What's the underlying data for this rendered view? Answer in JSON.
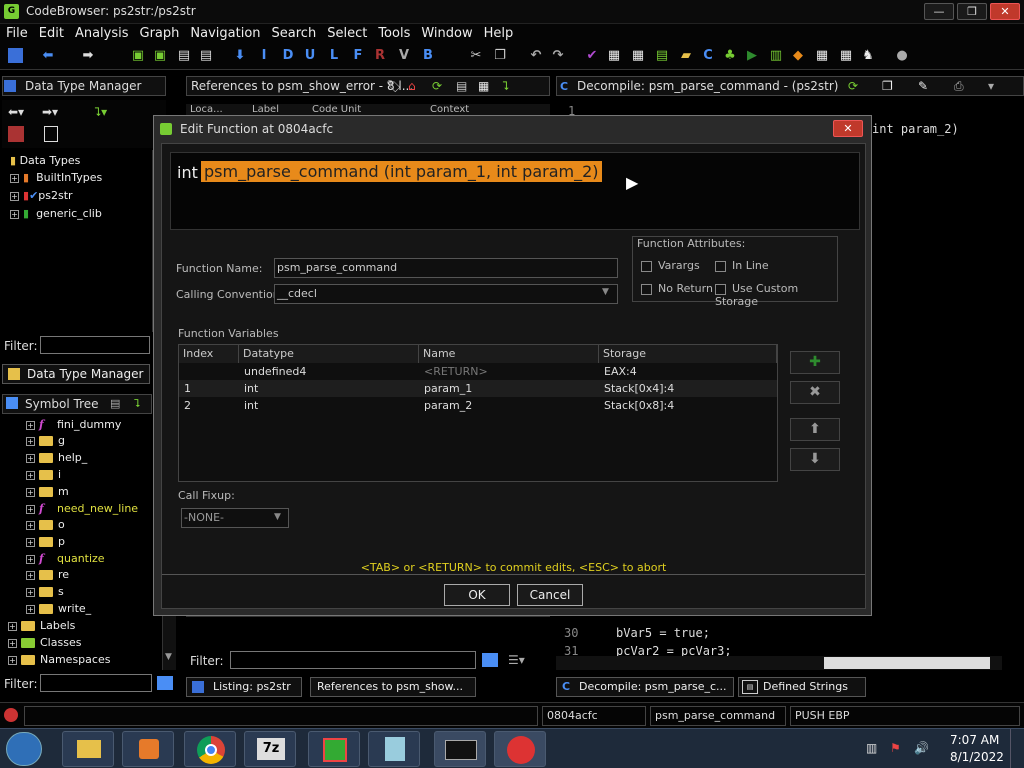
{
  "window": {
    "title": "CodeBrowser: ps2str:/ps2str",
    "controls": [
      "—",
      "❐",
      "✕"
    ]
  },
  "menu": [
    "File",
    "Edit",
    "Analysis",
    "Graph",
    "Navigation",
    "Search",
    "Select",
    "Tools",
    "Window",
    "Help"
  ],
  "toolbar_letters": [
    "I",
    "D",
    "U",
    "L",
    "F",
    "R",
    "V",
    "B"
  ],
  "dtm": {
    "title": "Data Type Manager",
    "root": "Data Types",
    "items": [
      "BuiltInTypes",
      "ps2str",
      "generic_clib"
    ],
    "filter_label": "Filter:",
    "tab_label": "Data Type Manager"
  },
  "symtree": {
    "title": "Symbol Tree",
    "items": [
      {
        "label": "fini_dummy",
        "kind": "func"
      },
      {
        "label": "g",
        "kind": "folder"
      },
      {
        "label": "help_",
        "kind": "folder"
      },
      {
        "label": "i",
        "kind": "folder"
      },
      {
        "label": "m",
        "kind": "folder"
      },
      {
        "label": "need_new_line",
        "kind": "func"
      },
      {
        "label": "o",
        "kind": "folder"
      },
      {
        "label": "p",
        "kind": "folder"
      },
      {
        "label": "quantize",
        "kind": "func"
      },
      {
        "label": "re",
        "kind": "folder"
      },
      {
        "label": "s",
        "kind": "folder"
      },
      {
        "label": "write_",
        "kind": "folder"
      }
    ],
    "roots": [
      "Labels",
      "Classes",
      "Namespaces"
    ],
    "filter_label": "Filter:"
  },
  "references": {
    "title": "References to psm_show_error - 8 l...",
    "filter_label": "Filter:",
    "col_fragments": [
      "Loca...",
      "Label",
      "Code Unit",
      "Context"
    ]
  },
  "decompile": {
    "title": "Decompile: psm_parse_command -  (ps2str)",
    "top_line_num": "1",
    "top_code": "int param_2)",
    "lines": [
      {
        "num": "30",
        "code": "bVar5 = true;"
      },
      {
        "num": "31",
        "code": "pcVar2 = pcVar3;"
      }
    ]
  },
  "dialog": {
    "title": "Edit Function at 0804acfc",
    "sig_prefix": "int",
    "sig_highlight": "psm_parse_command (int param_1, int param_2)",
    "function_name_label": "Function Name:",
    "function_name": "psm_parse_command",
    "calling_convention_label": "Calling Convention",
    "calling_convention": "__cdecl",
    "attributes_label": "Function Attributes:",
    "attributes": {
      "varargs": "Varargs",
      "inline": "In Line",
      "no_return": "No Return",
      "custom_storage": "Use Custom Storage"
    },
    "variables_label": "Function Variables",
    "columns": [
      "Index",
      "Datatype",
      "Name",
      "Storage"
    ],
    "rows": [
      {
        "index": "",
        "datatype": "undefined4",
        "name": "<RETURN>",
        "storage": "EAX:4"
      },
      {
        "index": "1",
        "datatype": "int",
        "name": "param_1",
        "storage": "Stack[0x4]:4"
      },
      {
        "index": "2",
        "datatype": "int",
        "name": "param_2",
        "storage": "Stack[0x8]:4"
      }
    ],
    "call_fixup_label": "Call Fixup:",
    "call_fixup": "-NONE-",
    "hint": "<TAB> or <RETURN> to commit edits, <ESC> to abort",
    "ok": "OK",
    "cancel": "Cancel"
  },
  "bottom_tabs": {
    "listing": "Listing:  ps2str",
    "references": "References to psm_show...",
    "decompile": "Decompile: psm_parse_c...",
    "defined_strings": "Defined Strings"
  },
  "status": {
    "address": "0804acfc",
    "function": "psm_parse_command",
    "instruction": "PUSH EBP"
  },
  "clock": {
    "time": "7:07 AM",
    "date": "8/1/2022"
  },
  "colors": {
    "highlight": "#e88a1a",
    "accent_green": "#2e8b2e"
  }
}
